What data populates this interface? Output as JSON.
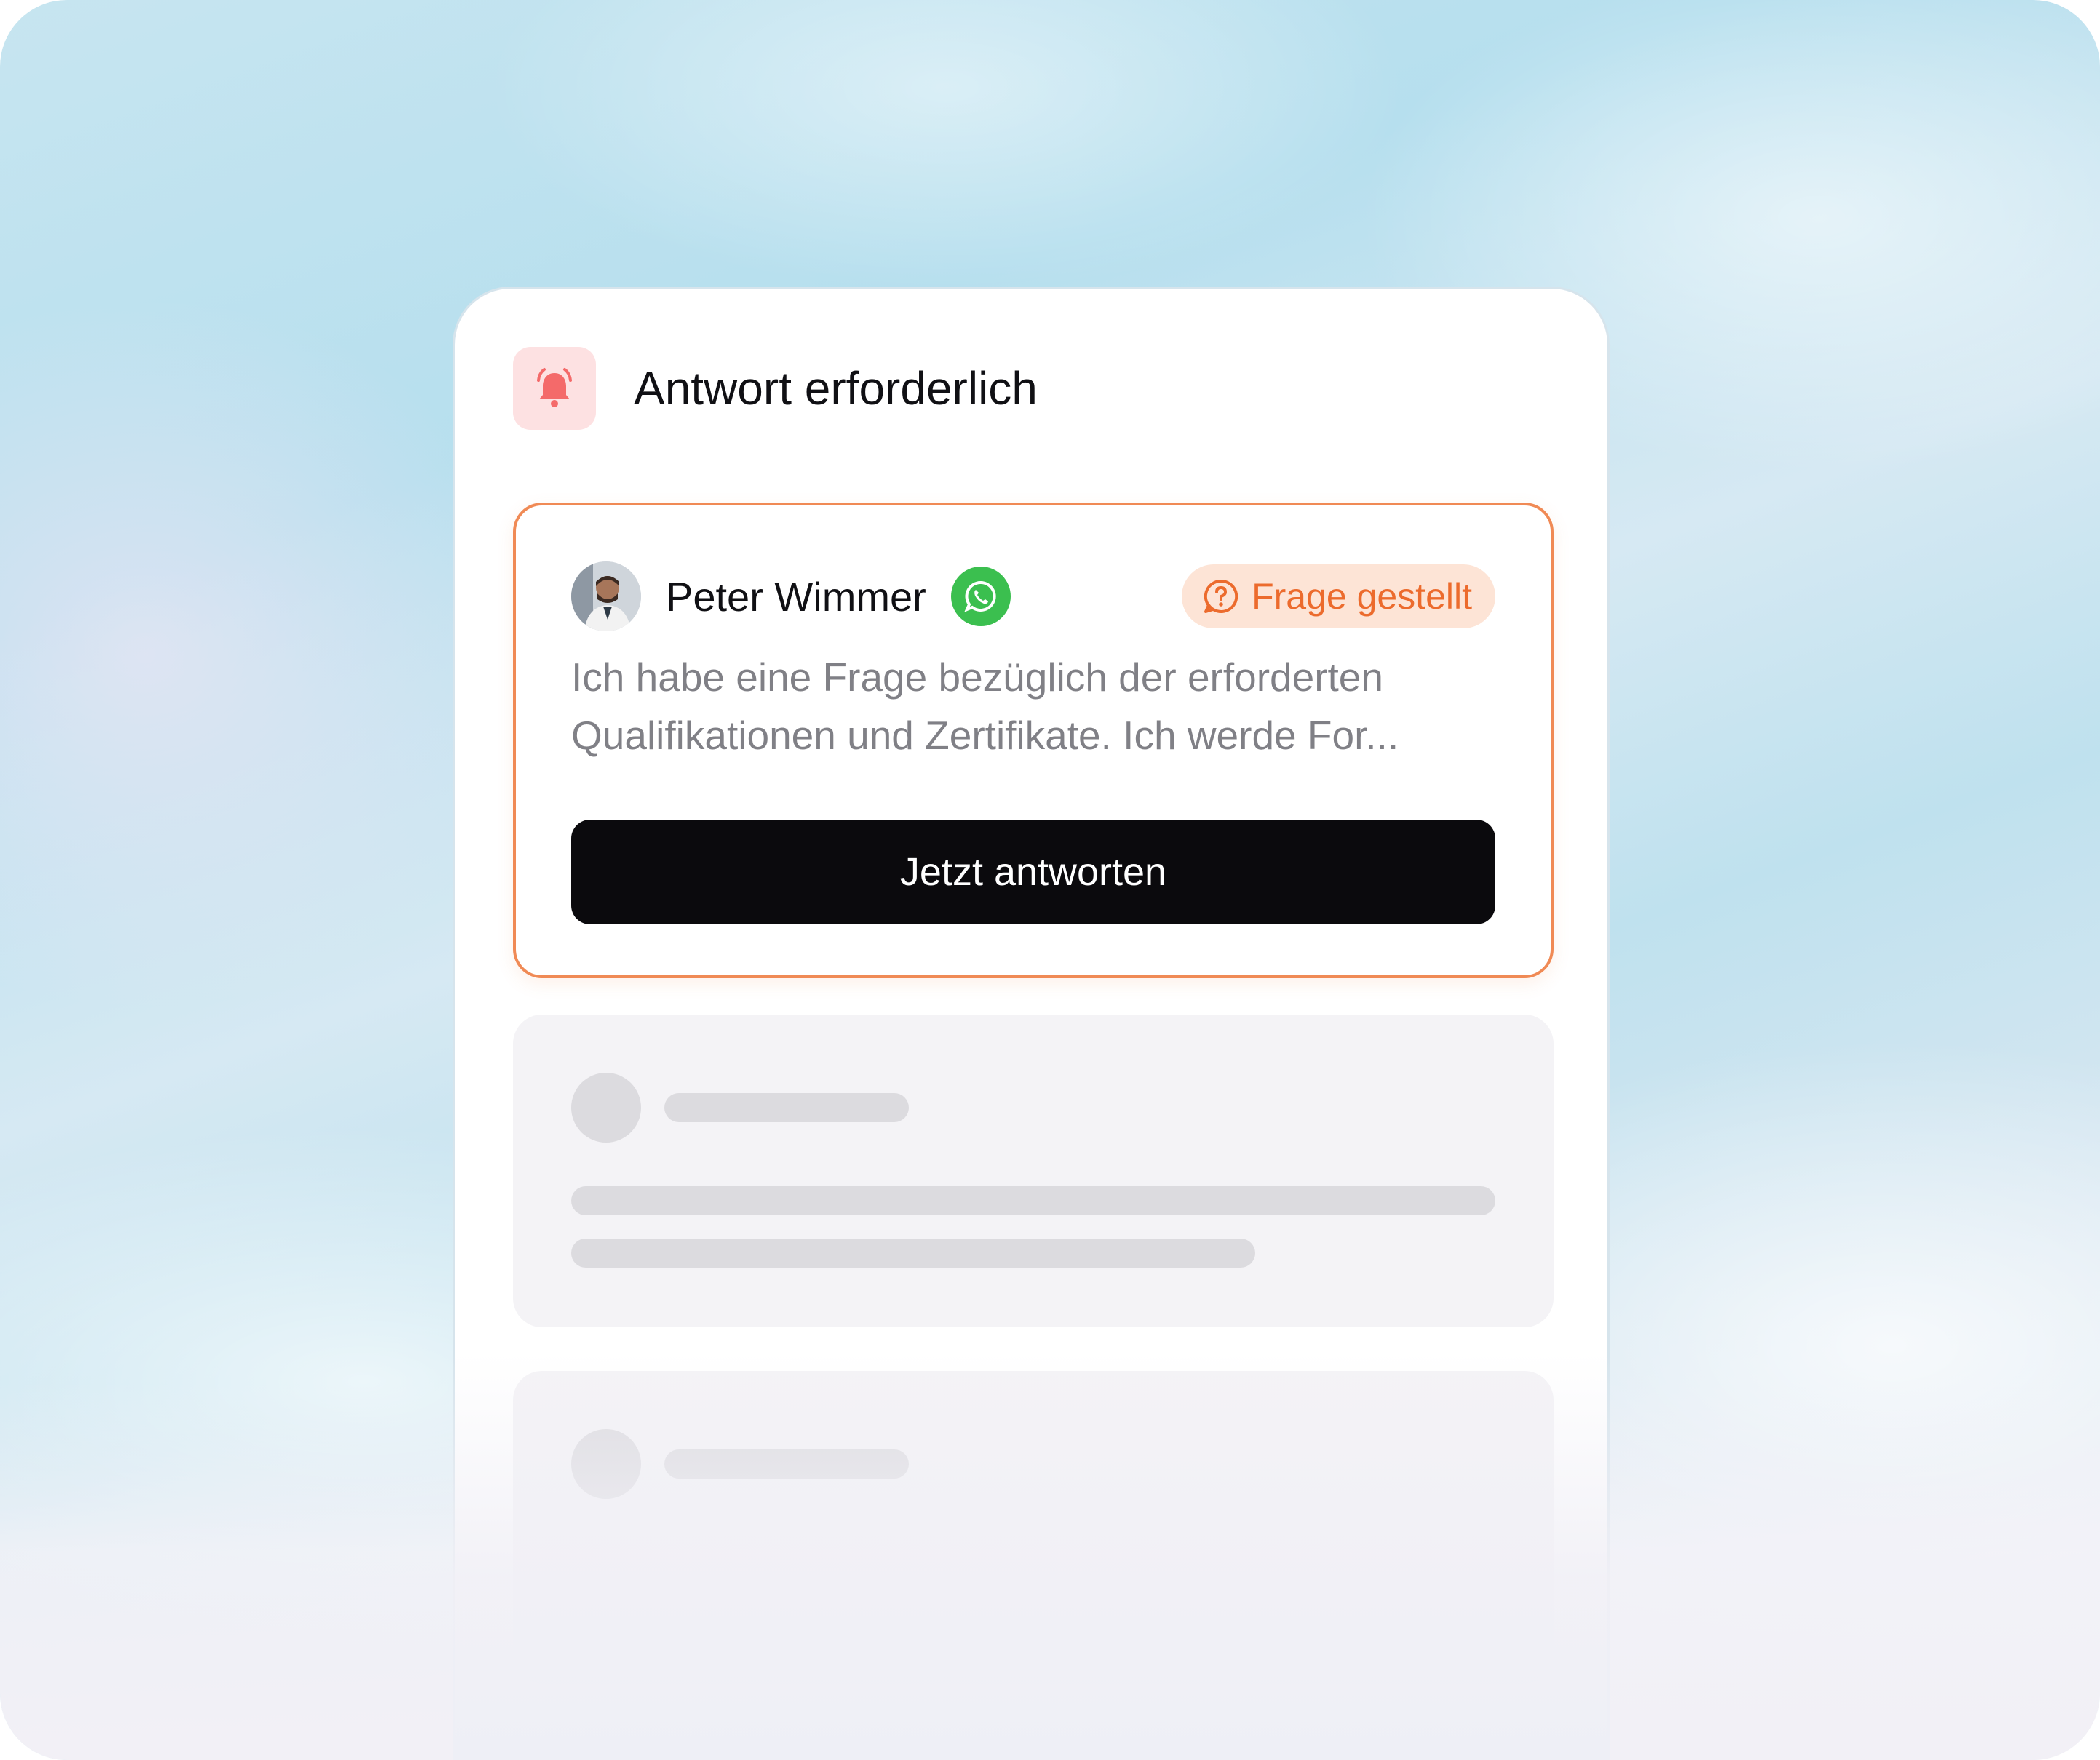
{
  "header": {
    "icon": "bell-ringing-icon",
    "title": "Antwort erforderlich"
  },
  "request_card": {
    "avatar": "user-avatar",
    "name": "Peter Wimmer",
    "channel_icon": "whatsapp-icon",
    "status": {
      "icon": "question-chat-icon",
      "label": "Frage gestellt"
    },
    "message_lines": [
      "Ich habe eine Frage bezüglich der erforderten",
      "Qualifikationen und Zertifikate. Ich werde For..."
    ],
    "reply_button": "Jetzt antworten"
  },
  "colors": {
    "accent": "#ec6b2d",
    "card_border": "#f08a55",
    "bell": "#f46a6a",
    "whatsapp": "#3bbf4f",
    "button": "#0b0a0d"
  }
}
